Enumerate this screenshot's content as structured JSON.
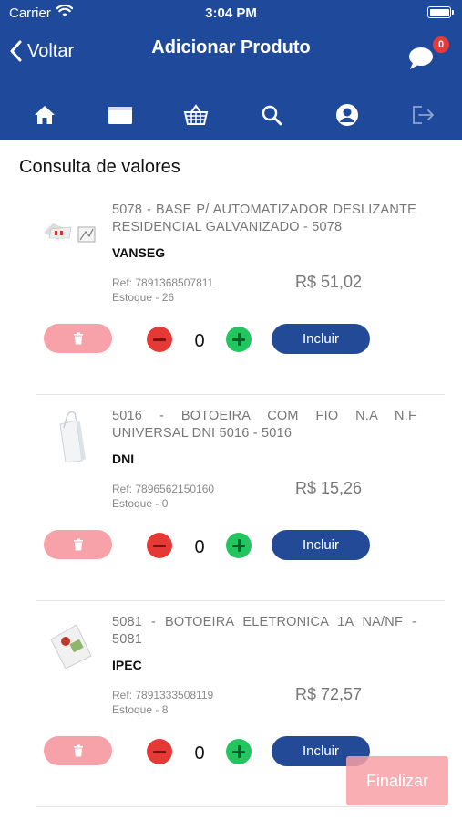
{
  "status_bar": {
    "carrier": "Carrier",
    "time": "3:04 PM"
  },
  "nav": {
    "back_label": "Voltar",
    "title": "Adicionar Produto",
    "chat_badge": "0"
  },
  "tabs": [
    "home-icon",
    "wallet-icon",
    "basket-icon",
    "search-icon",
    "user-icon",
    "logout-icon"
  ],
  "section_title": "Consulta de valores",
  "products": [
    {
      "name": "5078 - BASE P/ AUTOMATIZADOR DESLIZANTE RESIDENCIAL GALVANIZADO - 5078",
      "brand": "VANSEG",
      "ref": "Ref: 7891368507811",
      "stock": "Estoque - 26",
      "price": "R$ 51,02",
      "qty": "0",
      "add_label": "Incluir"
    },
    {
      "name": "5016 - BOTOEIRA COM FIO N.A N.F UNIVERSAL DNI 5016 - 5016",
      "brand": "DNI",
      "ref": "Ref: 7896562150160",
      "stock": "Estoque - 0",
      "price": "R$ 15,26",
      "qty": "0",
      "add_label": "Incluir"
    },
    {
      "name": "5081 - BOTOEIRA ELETRONICA 1A NA/NF - 5081",
      "brand": "IPEC",
      "ref": "Ref: 7891333508119",
      "stock": "Estoque - 8",
      "price": "R$ 72,57",
      "qty": "0",
      "add_label": "Incluir"
    }
  ],
  "finalize_label": "Finalizar",
  "colors": {
    "header": "#1f4a9c",
    "primary_button": "#234a96",
    "delete_button": "#f7a2a8",
    "minus": "#e53935",
    "plus": "#22c55e",
    "badge": "#e33b3b"
  }
}
